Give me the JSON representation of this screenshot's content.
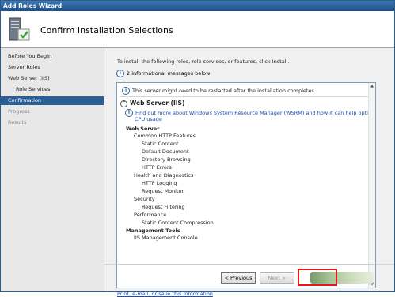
{
  "window": {
    "title": "Add Roles Wizard"
  },
  "header": {
    "title": "Confirm Installation Selections",
    "icon": "server-roles-icon"
  },
  "sidebar": {
    "items": [
      {
        "label": "Before You Begin",
        "state": "normal"
      },
      {
        "label": "Server Roles",
        "state": "normal"
      },
      {
        "label": "Web Server (IIS)",
        "state": "normal"
      },
      {
        "label": "Role Services",
        "state": "normal"
      },
      {
        "label": "Confirmation",
        "state": "active"
      },
      {
        "label": "Progress",
        "state": "disabled"
      },
      {
        "label": "Results",
        "state": "disabled"
      }
    ]
  },
  "main": {
    "intro": "To install the following roles, role services, or features, click Install.",
    "messages_count": "2 informational messages below",
    "restart_notice": "This server might need to be restarted after the installation completes.",
    "section_title": "Web Server (IIS)",
    "wsrm_link_line1": "Find out more about Windows System Resource Manager (WSRM) and how it can help optimize",
    "wsrm_link_line2": "CPU usage",
    "details": [
      "Web Server",
      "Common HTTP Features",
      "Static Content",
      "Default Document",
      "Directory Browsing",
      "HTTP Errors",
      "Health and Diagnostics",
      "HTTP Logging",
      "Request Monitor",
      "Security",
      "Request Filtering",
      "Performance",
      "Static Content Compression",
      "Management Tools",
      "IIS Management Console"
    ],
    "print_link": "Print, e-mail, or save this information"
  },
  "buttons": {
    "previous": "< Previous",
    "next": "Next >"
  },
  "colors": {
    "active_nav": "#2a5f96",
    "highlight": "#e01818",
    "link": "#1a4fb0"
  }
}
